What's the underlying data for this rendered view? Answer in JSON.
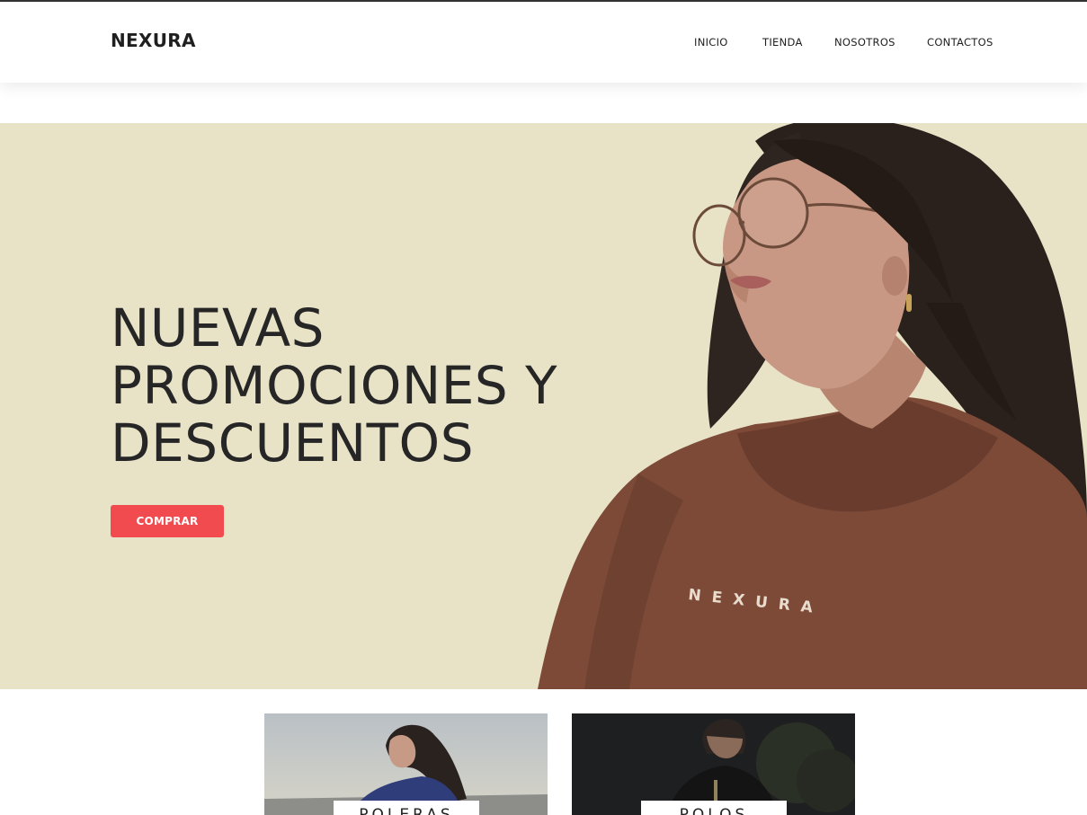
{
  "brand": {
    "name": "NEXURA",
    "colors": {
      "accent": "#f24b4f",
      "hero_bg": "#e8e3c7",
      "text": "#222222"
    }
  },
  "nav": {
    "items": [
      {
        "label": "INICIO"
      },
      {
        "label": "TIENDA"
      },
      {
        "label": "NOSOTROS"
      },
      {
        "label": "CONTACTOS"
      }
    ]
  },
  "hero": {
    "title_lines": [
      "NUEVAS",
      "PROMOCIONES Y",
      "DESCUENTOS"
    ],
    "cta_label": "COMPRAR",
    "hoodie_print": "NEXURA"
  },
  "categories": [
    {
      "label": "POLERAS"
    },
    {
      "label": "POLOS"
    }
  ]
}
